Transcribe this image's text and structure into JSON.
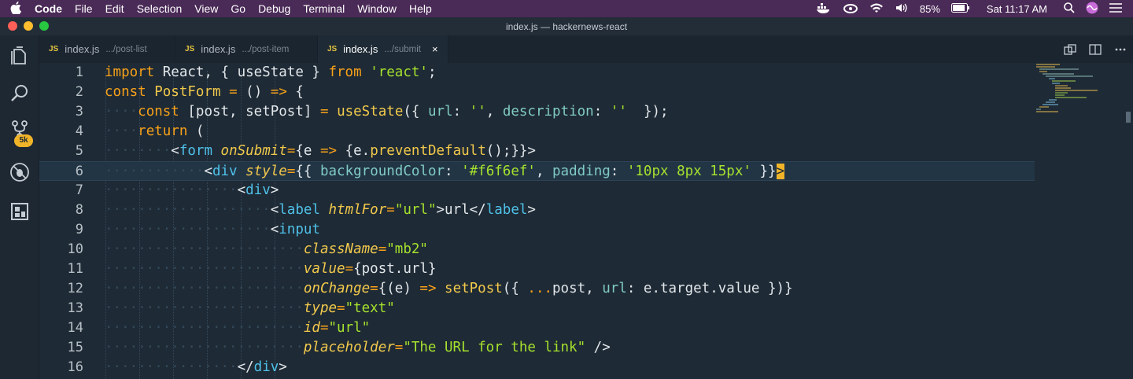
{
  "menubar": {
    "app": "Code",
    "items": [
      "File",
      "Edit",
      "Selection",
      "View",
      "Go",
      "Debug",
      "Terminal",
      "Window",
      "Help"
    ],
    "battery": "85%",
    "clock": "Sat 11:17 AM",
    "icons": [
      "apple-icon",
      "docker-icon",
      "creative-cloud-icon",
      "wifi-icon",
      "volume-icon",
      "battery-icon",
      "search-icon",
      "siri-icon",
      "menu-list-icon"
    ]
  },
  "window": {
    "title": "index.js — hackernews-react"
  },
  "activitybar": {
    "icons": [
      "explorer-icon",
      "search-icon",
      "source-control-icon",
      "debug-icon",
      "extensions-icon"
    ],
    "scm_badge": "5k"
  },
  "tabs": [
    {
      "icon": "JS",
      "name": "index.js",
      "path": ".../post-list"
    },
    {
      "icon": "JS",
      "name": "index.js",
      "path": ".../post-item"
    },
    {
      "icon": "JS",
      "name": "index.js",
      "path": ".../submit",
      "active": true,
      "close": "×"
    }
  ],
  "editor": {
    "colors": {
      "keyword": "#f7a11a",
      "function": "#f2c94c",
      "string": "#a6e22e",
      "property": "#80cbc4",
      "tag": "#4fc1e9",
      "background": "#1e2a35"
    },
    "current_line": 6,
    "lines": [
      {
        "n": "1",
        "tokens": [
          [
            "kw",
            "import"
          ],
          [
            "plain",
            " React, { useState } "
          ],
          [
            "kw",
            "from"
          ],
          [
            "plain",
            " "
          ],
          [
            "str",
            "'react'"
          ],
          [
            "plain",
            ";"
          ]
        ]
      },
      {
        "n": "2",
        "tokens": [
          [
            "kw",
            "const"
          ],
          [
            "plain",
            " "
          ],
          [
            "fn",
            "PostForm"
          ],
          [
            "plain",
            " "
          ],
          [
            "kw",
            "="
          ],
          [
            "plain",
            " () "
          ],
          [
            "kw",
            "=>"
          ],
          [
            "plain",
            " {"
          ]
        ]
      },
      {
        "n": "3",
        "tokens": [
          [
            "dots",
            "····"
          ],
          [
            "kw",
            "const"
          ],
          [
            "plain",
            " [post, setPost] "
          ],
          [
            "kw",
            "="
          ],
          [
            "plain",
            " "
          ],
          [
            "fn",
            "useState"
          ],
          [
            "plain",
            "({ "
          ],
          [
            "prop",
            "url"
          ],
          [
            "plain",
            ": "
          ],
          [
            "str",
            "''"
          ],
          [
            "plain",
            ", "
          ],
          [
            "prop",
            "description"
          ],
          [
            "plain",
            ": "
          ],
          [
            "str",
            "''"
          ],
          [
            "plain",
            "  });"
          ]
        ]
      },
      {
        "n": "4",
        "tokens": [
          [
            "dots",
            "····"
          ],
          [
            "kw",
            "return"
          ],
          [
            "plain",
            " ("
          ]
        ]
      },
      {
        "n": "5",
        "tokens": [
          [
            "dots",
            "········"
          ],
          [
            "plain",
            "<"
          ],
          [
            "tag",
            "form"
          ],
          [
            "plain",
            " "
          ],
          [
            "attr",
            "onSubmit"
          ],
          [
            "kw",
            "="
          ],
          [
            "plain",
            "{e "
          ],
          [
            "kw",
            "=>"
          ],
          [
            "plain",
            " {e."
          ],
          [
            "fn",
            "preventDefault"
          ],
          [
            "plain",
            "();}}>"
          ]
        ]
      },
      {
        "n": "6",
        "tokens": [
          [
            "dots",
            "············"
          ],
          [
            "plain",
            "<"
          ],
          [
            "tag",
            "div"
          ],
          [
            "plain",
            " "
          ],
          [
            "attr",
            "style"
          ],
          [
            "kw",
            "="
          ],
          [
            "plain",
            "{{ "
          ],
          [
            "prop",
            "backgroundColor"
          ],
          [
            "plain",
            ": "
          ],
          [
            "str",
            "'#f6f6ef'"
          ],
          [
            "plain",
            ", "
          ],
          [
            "prop",
            "padding"
          ],
          [
            "plain",
            ": "
          ],
          [
            "str",
            "'10px 8px 15px'"
          ],
          [
            "plain",
            " }}"
          ],
          [
            "cursor",
            ">"
          ]
        ]
      },
      {
        "n": "7",
        "tokens": [
          [
            "dots",
            "················"
          ],
          [
            "plain",
            "<"
          ],
          [
            "tag",
            "div"
          ],
          [
            "plain",
            ">"
          ]
        ]
      },
      {
        "n": "8",
        "tokens": [
          [
            "dots",
            "····················"
          ],
          [
            "plain",
            "<"
          ],
          [
            "tag",
            "label"
          ],
          [
            "plain",
            " "
          ],
          [
            "attr",
            "htmlFor"
          ],
          [
            "kw",
            "="
          ],
          [
            "str",
            "\"url\""
          ],
          [
            "plain",
            ">url</"
          ],
          [
            "tag",
            "label"
          ],
          [
            "plain",
            ">"
          ]
        ]
      },
      {
        "n": "9",
        "tokens": [
          [
            "dots",
            "····················"
          ],
          [
            "plain",
            "<"
          ],
          [
            "tag",
            "input"
          ]
        ]
      },
      {
        "n": "10",
        "tokens": [
          [
            "dots",
            "························"
          ],
          [
            "attr",
            "className"
          ],
          [
            "kw",
            "="
          ],
          [
            "str",
            "\"mb2\""
          ]
        ]
      },
      {
        "n": "11",
        "tokens": [
          [
            "dots",
            "························"
          ],
          [
            "attr",
            "value"
          ],
          [
            "kw",
            "="
          ],
          [
            "plain",
            "{post.url}"
          ]
        ]
      },
      {
        "n": "12",
        "tokens": [
          [
            "dots",
            "························"
          ],
          [
            "attr",
            "onChange"
          ],
          [
            "kw",
            "="
          ],
          [
            "plain",
            "{(e) "
          ],
          [
            "kw",
            "=>"
          ],
          [
            "plain",
            " "
          ],
          [
            "fn",
            "setPost"
          ],
          [
            "plain",
            "({ "
          ],
          [
            "kw",
            "..."
          ],
          [
            "plain",
            "post, "
          ],
          [
            "prop",
            "url"
          ],
          [
            "plain",
            ": e.target.value })}"
          ]
        ]
      },
      {
        "n": "13",
        "tokens": [
          [
            "dots",
            "························"
          ],
          [
            "attr",
            "type"
          ],
          [
            "kw",
            "="
          ],
          [
            "str",
            "\"text\""
          ]
        ]
      },
      {
        "n": "14",
        "tokens": [
          [
            "dots",
            "························"
          ],
          [
            "attr",
            "id"
          ],
          [
            "kw",
            "="
          ],
          [
            "str",
            "\"url\""
          ]
        ]
      },
      {
        "n": "15",
        "tokens": [
          [
            "dots",
            "························"
          ],
          [
            "attr",
            "placeholder"
          ],
          [
            "kw",
            "="
          ],
          [
            "str",
            "\"The URL for the link\""
          ],
          [
            "plain",
            " />"
          ]
        ]
      },
      {
        "n": "16",
        "tokens": [
          [
            "dots",
            "················"
          ],
          [
            "plain",
            "</"
          ],
          [
            "tag",
            "div"
          ],
          [
            "plain",
            ">"
          ]
        ]
      }
    ]
  }
}
